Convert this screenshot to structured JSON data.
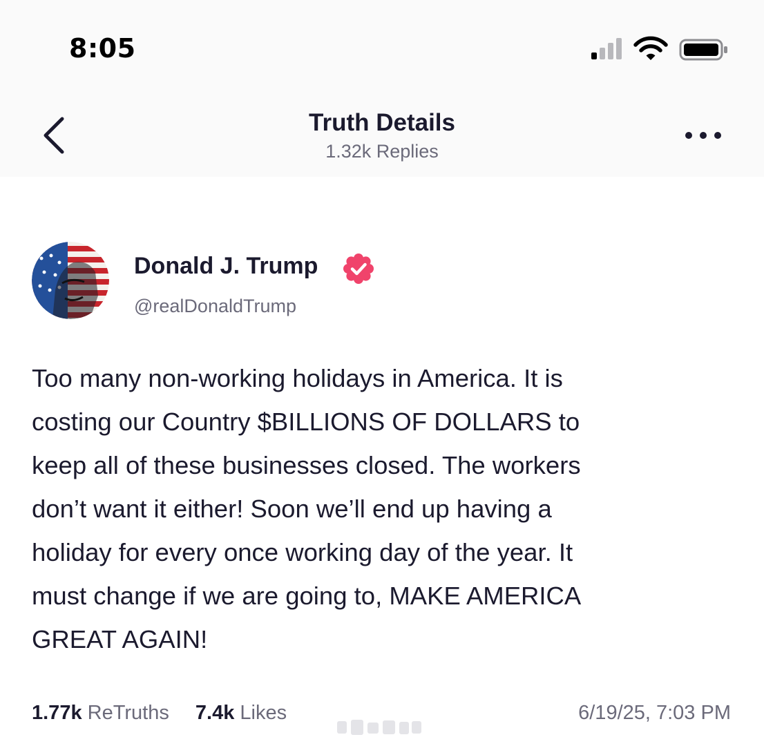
{
  "status_bar": {
    "time": "8:05",
    "icons": [
      "cellular-signal-icon",
      "wifi-icon",
      "battery-icon"
    ]
  },
  "header": {
    "title": "Truth Details",
    "subtitle": "1.32k Replies",
    "back_icon": "chevron-left-icon",
    "more_icon": "more-horizontal-icon"
  },
  "post": {
    "author": {
      "name": "Donald J. Trump",
      "handle": "@realDonaldTrump",
      "verified": true
    },
    "text": "Too many non-working holidays in America. It is\ncosting our Country $BILLIONS OF DOLLARS to\nkeep all of these businesses closed. The workers\ndon’t want it either! Soon we’ll end up having a\nholiday for every once working day of the year. It\nmust change if we are going to, MAKE AMERICA\nGREAT AGAIN!",
    "stats": {
      "retruths_count": "1.77k",
      "retruths_label": "ReTruths",
      "likes_count": "7.4k",
      "likes_label": "Likes"
    },
    "timestamp": "6/19/25, 7:03 PM"
  },
  "colors": {
    "text_primary": "#1b1a2e",
    "text_secondary": "#6b6a7a",
    "verified_badge": "#f0436b",
    "header_background": "#fafafa"
  }
}
